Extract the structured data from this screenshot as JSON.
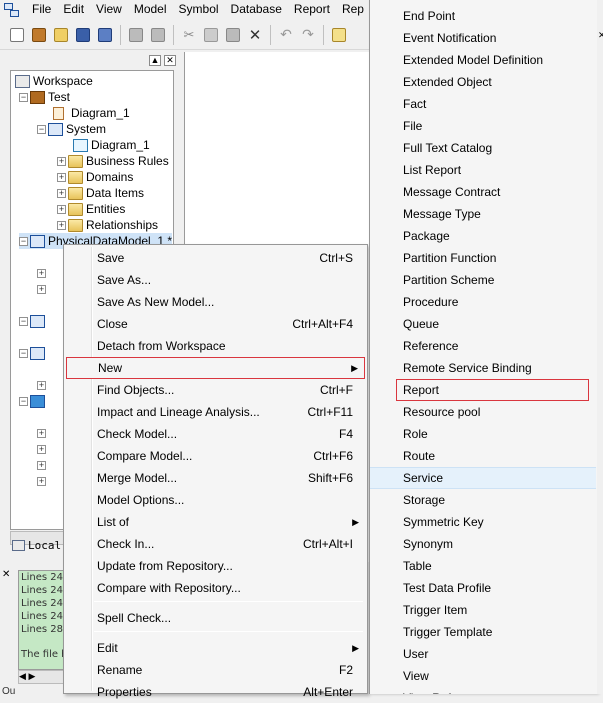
{
  "menubar": {
    "items": [
      "File",
      "Edit",
      "View",
      "Model",
      "Symbol",
      "Database",
      "Report",
      "Rep"
    ]
  },
  "toolbar": {
    "icons": [
      "new-icon",
      "open-model-icon",
      "open-folder-icon",
      "save-icon",
      "save-all-icon",
      "print-preview-icon",
      "print-icon",
      "cut-icon",
      "copy-icon",
      "paste-icon",
      "delete-icon",
      "undo-icon",
      "redo-icon",
      "properties-icon"
    ]
  },
  "workspace": {
    "tab_label": "Local",
    "tree": [
      {
        "label": "Workspace",
        "icon": "workspace-icon"
      },
      {
        "label": "Test",
        "icon": "project-icon"
      },
      {
        "label": "Diagram_1",
        "icon": "diagram-icon"
      },
      {
        "label": "System",
        "icon": "model-icon"
      },
      {
        "label": "Diagram_1",
        "icon": "diagram-icon"
      },
      {
        "label": "Business Rules",
        "icon": "folder-icon"
      },
      {
        "label": "Domains",
        "icon": "folder-icon"
      },
      {
        "label": "Data Items",
        "icon": "folder-icon"
      },
      {
        "label": "Entities",
        "icon": "folder-icon"
      },
      {
        "label": "Relationships",
        "icon": "folder-icon"
      },
      {
        "label": "PhysicalDataModel_1 *",
        "icon": "model-icon"
      }
    ]
  },
  "output": {
    "lines": [
      "Lines  24",
      "Lines  24",
      "Lines  24",
      "Lines  24",
      "Lines  28"
    ],
    "message": "The file h",
    "status": "Ou"
  },
  "context_menu": {
    "items": [
      {
        "label": "Save",
        "shortcut": "Ctrl+S"
      },
      {
        "label": "Save As...",
        "shortcut": ""
      },
      {
        "label": "Save As New Model...",
        "shortcut": ""
      },
      {
        "label": "Close",
        "shortcut": "Ctrl+Alt+F4"
      },
      {
        "label": "Detach from Workspace",
        "shortcut": ""
      },
      {
        "label": "New",
        "shortcut": "",
        "submenu": true
      },
      {
        "label": "Find Objects...",
        "shortcut": "Ctrl+F"
      },
      {
        "label": "Impact and Lineage Analysis...",
        "shortcut": "Ctrl+F11"
      },
      {
        "label": "Check Model...",
        "shortcut": "F4"
      },
      {
        "label": "Compare Model...",
        "shortcut": "Ctrl+F6"
      },
      {
        "label": "Merge Model...",
        "shortcut": "Shift+F6"
      },
      {
        "label": "Model Options...",
        "shortcut": ""
      },
      {
        "label": "List of",
        "shortcut": "",
        "submenu": true
      },
      {
        "label": "Check In...",
        "shortcut": "Ctrl+Alt+I"
      },
      {
        "label": "Update from Repository...",
        "shortcut": ""
      },
      {
        "label": "Compare with Repository...",
        "shortcut": ""
      },
      {
        "label": "Spell Check...",
        "shortcut": ""
      },
      {
        "label": "Edit",
        "shortcut": "",
        "submenu": true
      },
      {
        "label": "Rename",
        "shortcut": "F2"
      },
      {
        "label": "Properties",
        "shortcut": "Alt+Enter"
      }
    ]
  },
  "sub_menu": {
    "items": [
      "End Point",
      "Event Notification",
      "Extended Model Definition",
      "Extended Object",
      "Fact",
      "File",
      "Full Text Catalog",
      "List Report",
      "Message Contract",
      "Message Type",
      "Package",
      "Partition Function",
      "Partition Scheme",
      "Procedure",
      "Queue",
      "Reference",
      "Remote Service Binding",
      "Report",
      "Resource pool",
      "Role",
      "Route",
      "Service",
      "Storage",
      "Symmetric Key",
      "Synonym",
      "Table",
      "Test Data Profile",
      "Trigger Item",
      "Trigger Template",
      "User",
      "View",
      "View Ref"
    ],
    "highlighted": "Report",
    "hovered": "Service"
  },
  "colors": {
    "highlight_border": "#d9363e",
    "hover_bg": "#e5f1fb",
    "log_bg": "#c5e8c5"
  }
}
